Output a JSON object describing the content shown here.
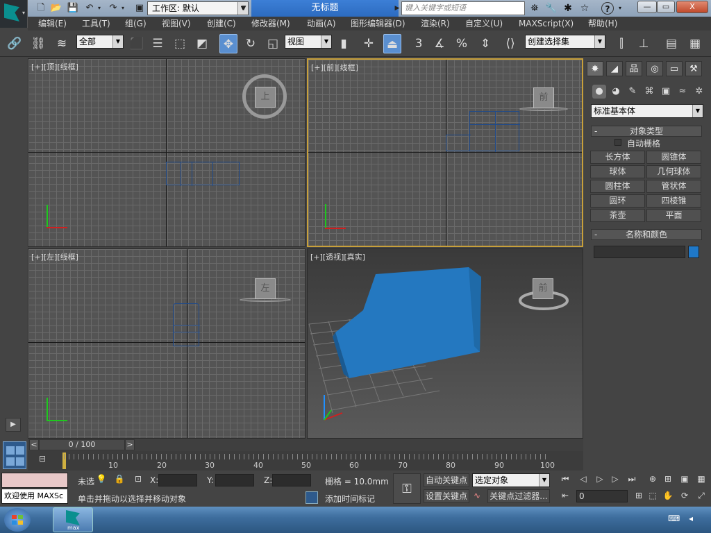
{
  "titlebar": {
    "workspace_label": "工作区: 默认",
    "doc_title": "无标题",
    "search_placeholder": "键入关键字或短语",
    "help_label": "?",
    "min": "—",
    "max": "▭",
    "close": "X"
  },
  "menubar": {
    "items": [
      "编辑(E)",
      "工具(T)",
      "组(G)",
      "视图(V)",
      "创建(C)",
      "修改器(M)",
      "动画(A)",
      "图形编辑器(D)",
      "渲染(R)",
      "自定义(U)",
      "MAXScript(X)",
      "帮助(H)"
    ]
  },
  "toolbar": {
    "filter_value": "全部",
    "refcoord_value": "视图",
    "snap_label": "3",
    "angle_label": "%",
    "selset_value": "创建选择集"
  },
  "viewports": {
    "top": {
      "label": "[+][顶][线框]",
      "cube": "上"
    },
    "front": {
      "label": "[+][前][线框]",
      "cube": "前"
    },
    "left": {
      "label": "[+][左][线框]",
      "cube": "左"
    },
    "persp": {
      "label": "[+][透视][真实]",
      "cube": "前"
    }
  },
  "command_panel": {
    "category_value": "标准基本体",
    "object_type_title": "对象类型",
    "autogrid_label": "自动栅格",
    "objects": [
      "长方体",
      "圆锥体",
      "球体",
      "几何球体",
      "圆柱体",
      "管状体",
      "圆环",
      "四棱锥",
      "茶壶",
      "平面"
    ],
    "name_color_title": "名称和颜色",
    "collapse": "-",
    "object_color": "#1f78c8"
  },
  "timeline": {
    "frame_display": "0 / 100",
    "prev": "<",
    "next": ">",
    "ticks": [
      "10",
      "20",
      "30",
      "40",
      "50",
      "60",
      "70",
      "80",
      "90",
      "100"
    ]
  },
  "status": {
    "script_text": "欢迎使用 MAXSc",
    "selection_label": "未选",
    "x_label": "X:",
    "y_label": "Y:",
    "z_label": "Z:",
    "grid_text": "栅格 = 10.0mm",
    "prompt_text": "单击并拖动以选择并移动对象",
    "add_time_tag": "添加时间标记",
    "autokey_label": "自动关键点",
    "setkey_label": "设置关键点",
    "selected_value": "选定对象",
    "key_filters": "关键点过滤器...",
    "frame_value": "0"
  },
  "taskbar": {
    "app_label": "max"
  }
}
